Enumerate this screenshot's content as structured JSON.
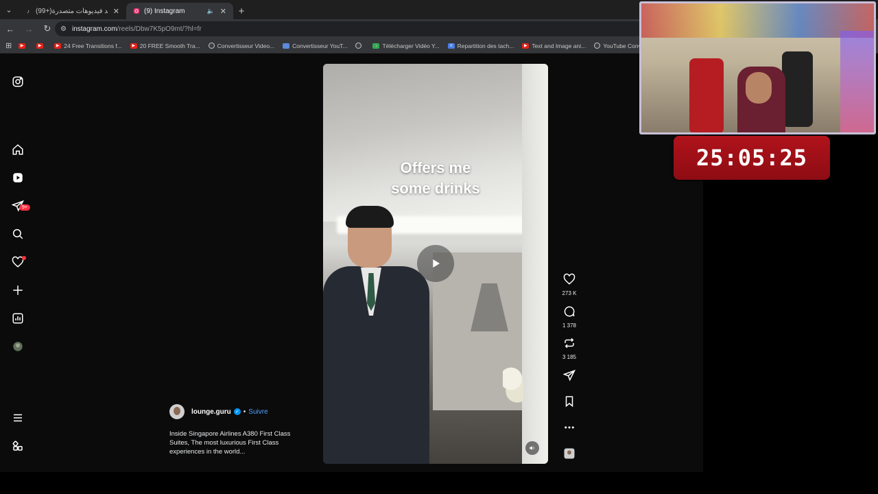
{
  "browser": {
    "tabs": [
      {
        "title": "(99+)شاهد فيديوهات متصدرة | ",
        "active": false
      },
      {
        "title": "(9) Instagram",
        "active": true
      }
    ],
    "url_host": "instagram.com",
    "url_path": "/reels/Dbw7K5pO9mt/?hl=fr",
    "bookmarks": [
      {
        "label": "",
        "icon": "youtube-icon"
      },
      {
        "label": "",
        "icon": "youtube-icon"
      },
      {
        "label": "24 Free Transitions f...",
        "icon": "youtube-icon"
      },
      {
        "label": "20 FREE Smooth Tra...",
        "icon": "youtube-icon"
      },
      {
        "label": "Convertisseur Video...",
        "icon": "google-icon"
      },
      {
        "label": "Convertisseur YouT...",
        "icon": "converter-icon"
      },
      {
        "label": "",
        "icon": "globe-icon"
      },
      {
        "label": "Télécharger Vidéo Y...",
        "icon": "download-icon"
      },
      {
        "label": "Repartition des tach...",
        "icon": "docs-icon"
      },
      {
        "label": "Text and Image ani...",
        "icon": "youtube-icon"
      },
      {
        "label": "YouTube Converter...",
        "icon": "globe-icon"
      }
    ]
  },
  "sidebar": {
    "notification_badge": "9+"
  },
  "reel": {
    "overlay_text_line1": "Offers me",
    "overlay_text_line2": "some drinks",
    "author": "lounge.guru",
    "follow_label": "Suivre",
    "separator": "•",
    "description": "Inside Singapore Airlines A380 First Class Suites, The most luxurious First Class experiences in the world...",
    "likes": "273 K",
    "comments": "1 378",
    "reposts": "3 185"
  },
  "overlay": {
    "timer": "25:05:25"
  },
  "colors": {
    "badge": "#ff3040",
    "link": "#4ea3ff",
    "verified": "#0095f6",
    "timer_bg": "#b0131b"
  }
}
